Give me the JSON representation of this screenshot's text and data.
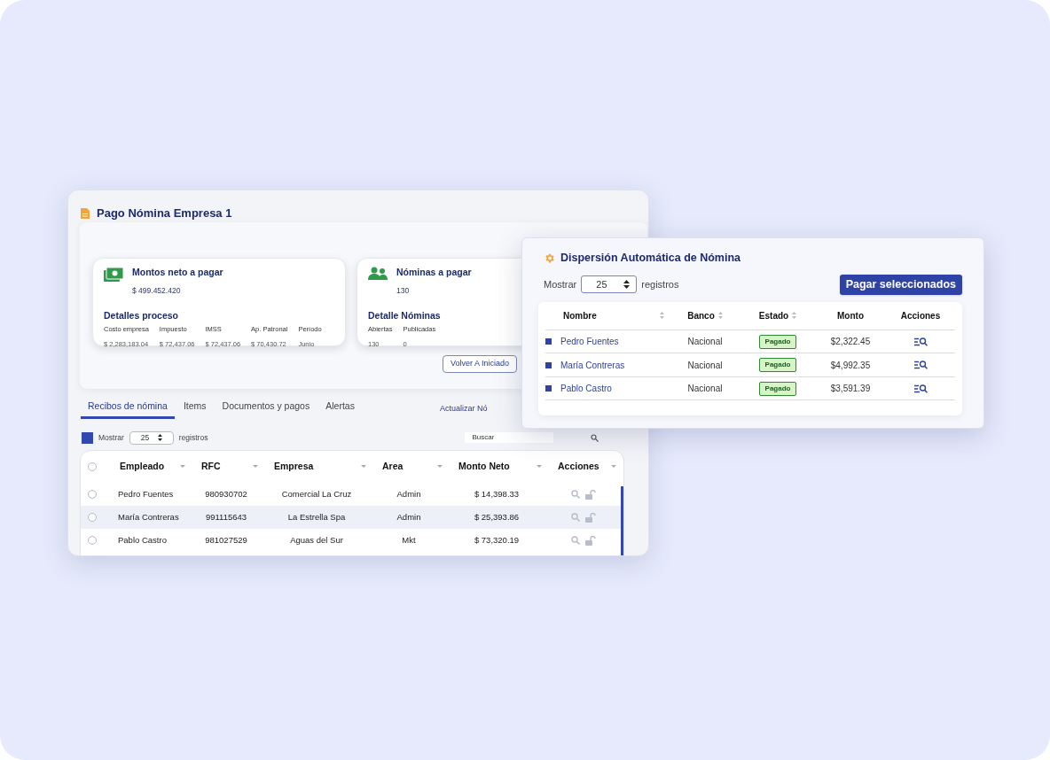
{
  "main_window": {
    "title": "Pago Nómina Empresa 1",
    "cards": [
      {
        "kind": "money",
        "title": "Montos neto a pagar",
        "value": "$ 499.452.420",
        "section": "Detalles proceso",
        "columns": [
          {
            "label": "Costo empresa",
            "value": "$ 2,283,183.04"
          },
          {
            "label": "Impuesto",
            "value": "$ 72,437.06"
          },
          {
            "label": "IMSS",
            "value": "$ 72,437.06"
          },
          {
            "label": "Ap. Patronal",
            "value": "$ 70,430.72"
          },
          {
            "label": "Período",
            "value": "Junio"
          }
        ]
      },
      {
        "kind": "people",
        "title": "Nóminas a pagar",
        "value": "130",
        "section": "Detalle Nóminas",
        "columns": [
          {
            "label": "Abiertas",
            "value": "130"
          },
          {
            "label": "Publicadas",
            "value": "0"
          }
        ]
      }
    ],
    "back_button": "Volver A Iniciado",
    "tabs": [
      {
        "label": "Recibos de nómina",
        "selected": true
      },
      {
        "label": "Items",
        "selected": false
      },
      {
        "label": "Documentos y pagos",
        "selected": false
      },
      {
        "label": "Alertas",
        "selected": false
      }
    ],
    "update_link": "Actualizar Nó",
    "show": {
      "label": "Mostrar",
      "value": "25",
      "suffix": "registros"
    },
    "search": {
      "placeholder": "Buscar"
    },
    "table": {
      "all_checked": false,
      "columns": [
        "Empleado",
        "RFC",
        "Empresa",
        "Area",
        "Monto Neto",
        "Acciones"
      ],
      "rows": [
        {
          "cells": [
            "Pedro Fuentes",
            "980930702",
            "Comercial La Cruz",
            "Admin",
            "$ 14,398.33"
          ],
          "checked": false,
          "selected": false
        },
        {
          "cells": [
            "María Contreras",
            "991115643",
            "La Estrella Spa",
            "Admin",
            "$ 25,393.86"
          ],
          "checked": false,
          "selected": true
        },
        {
          "cells": [
            "Pablo Castro",
            "981027529",
            "Aguas del Sur",
            "Mkt",
            "$ 73,320.19"
          ],
          "checked": false,
          "selected": false
        }
      ]
    }
  },
  "dispersion_window": {
    "title": "Dispersión Automática de Nómina",
    "show": {
      "label": "Mostrar",
      "value": "25",
      "suffix": "registros"
    },
    "pay_button": "Pagar seleccionados",
    "table": {
      "columns": [
        {
          "label": "Nombre",
          "sortable": true
        },
        {
          "label": "Banco",
          "sortable": true
        },
        {
          "label": "Estado",
          "sortable": true
        },
        {
          "label": "Monto",
          "sortable": false
        },
        {
          "label": "Acciones",
          "sortable": false
        }
      ],
      "rows": [
        {
          "name": "Pedro Fuentes",
          "bank": "Nacional",
          "status": "Pagado",
          "amount": "$2,322.45",
          "checked": true
        },
        {
          "name": "María Contreras",
          "bank": "Nacional",
          "status": "Pagado",
          "amount": "$4,992.35",
          "checked": true
        },
        {
          "name": "Pablo Castro",
          "bank": "Nacional",
          "status": "Pagado",
          "amount": "$3,591.39",
          "checked": true
        }
      ]
    }
  }
}
